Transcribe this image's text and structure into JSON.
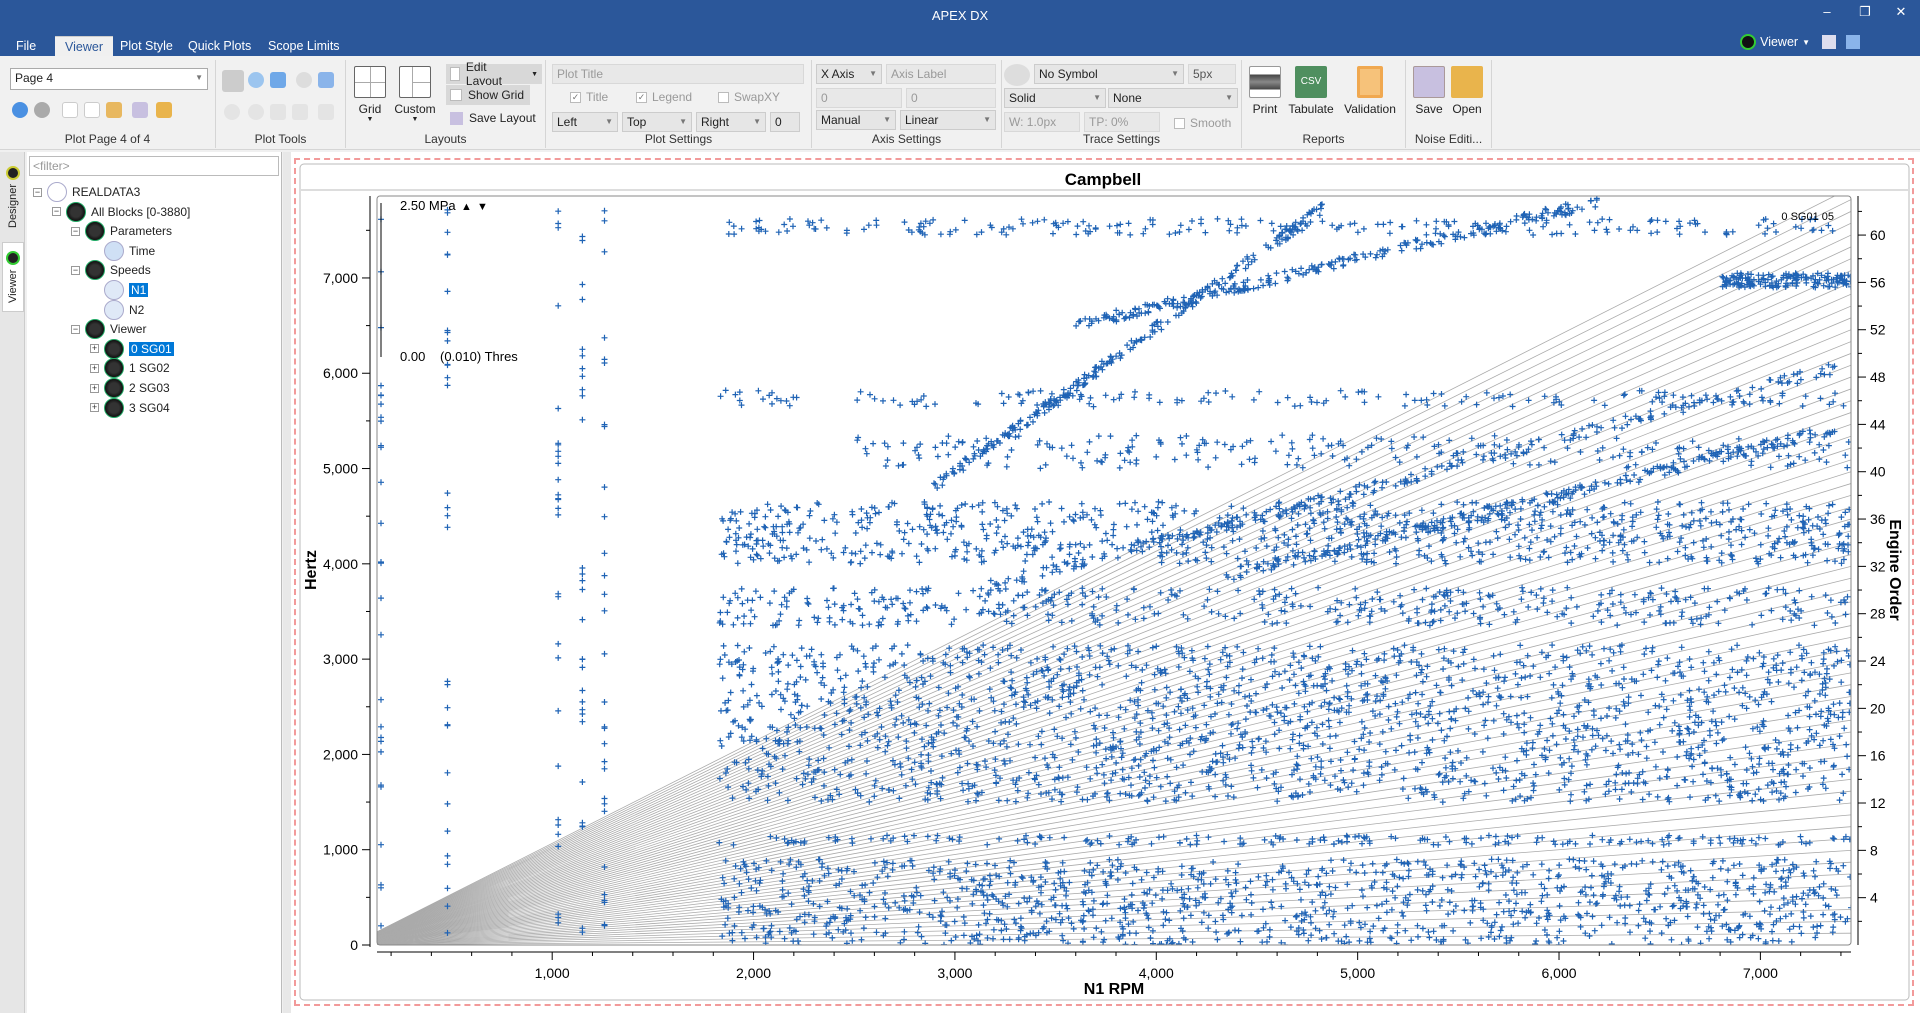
{
  "window": {
    "title": "APEX DX",
    "minimize": "‒",
    "restore": "❐",
    "close": "✕"
  },
  "menu": {
    "tabs": [
      "File",
      "Viewer",
      "Plot Style",
      "Quick Plots",
      "Scope Limits"
    ],
    "active": "Viewer",
    "mode_label": "Viewer"
  },
  "ribbon": {
    "plot_page": {
      "page_select": "Page 4",
      "label": "Plot Page 4 of 4"
    },
    "plot_tools": {
      "label": "Plot Tools"
    },
    "layouts": {
      "grid": "Grid",
      "custom": "Custom",
      "edit_layout": "Edit Layout",
      "show_grid": "Show Grid",
      "save_layout": "Save Layout",
      "label": "Layouts"
    },
    "plot_settings": {
      "title_placeholder": "Plot Title",
      "title_check": "Title",
      "title_checked": true,
      "legend_check": "Legend",
      "legend_checked": true,
      "swapxy_check": "SwapXY",
      "swapxy_checked": false,
      "left": "Left",
      "top": "Top",
      "right": "Right",
      "spin": "0",
      "label": "Plot Settings"
    },
    "axis_settings": {
      "axis": "X Axis",
      "axis_label_placeholder": "Axis Label",
      "min": "0",
      "max": "0",
      "mode": "Manual",
      "scale": "Linear",
      "label": "Axis Settings"
    },
    "trace_settings": {
      "symbol": "No Symbol",
      "size": "5px",
      "line": "Solid",
      "fill": "None",
      "width": "W: 1.0px",
      "transparency": "TP: 0%",
      "smooth": "Smooth",
      "smooth_checked": false,
      "label": "Trace Settings"
    },
    "reports": {
      "print": "Print",
      "tabulate": "Tabulate",
      "validation": "Validation",
      "label": "Reports"
    },
    "noise": {
      "save": "Save",
      "open": "Open",
      "label": "Noise Editi..."
    }
  },
  "side_tabs": [
    "Designer",
    "Viewer"
  ],
  "tree": {
    "filter_placeholder": "<filter>",
    "nodes": [
      {
        "label": "REALDATA3",
        "level": 0,
        "expander": "−",
        "icon": "file-icon"
      },
      {
        "label": "All Blocks [0-3880]",
        "level": 1,
        "expander": "−",
        "icon": "blocks-icon"
      },
      {
        "label": "Parameters",
        "level": 2,
        "expander": "−",
        "icon": "gauge-icon"
      },
      {
        "label": "Time",
        "level": 3,
        "expander": "",
        "icon": "stopwatch-icon"
      },
      {
        "label": "Speeds",
        "level": 2,
        "expander": "−",
        "icon": "gauge-icon"
      },
      {
        "label": "N1",
        "level": 3,
        "expander": "",
        "icon": "speedometer-icon",
        "selected": true
      },
      {
        "label": "N2",
        "level": 3,
        "expander": "",
        "icon": "speedometer-icon"
      },
      {
        "label": "Viewer",
        "level": 2,
        "expander": "−",
        "icon": "binoculars-icon"
      },
      {
        "label": "0 SG01",
        "level": 3,
        "expander": "+",
        "icon": "sensor-icon",
        "selected": true
      },
      {
        "label": "1 SG02",
        "level": 3,
        "expander": "+",
        "icon": "sensor-icon"
      },
      {
        "label": "2 SG03",
        "level": 3,
        "expander": "+",
        "icon": "sensor-icon"
      },
      {
        "label": "3 SG04",
        "level": 3,
        "expander": "+",
        "icon": "sensor-icon"
      }
    ]
  },
  "chart_data": {
    "type": "scatter",
    "title": "Campbell",
    "xlabel": "N1 RPM",
    "ylabel": "Hertz",
    "y2label": "Engine Order",
    "xlim": [
      130,
      7450
    ],
    "ylim": [
      0,
      7860
    ],
    "xticks": [
      1000,
      2000,
      3000,
      4000,
      5000,
      6000,
      7000
    ],
    "xtick_labels": [
      "1,000",
      "2,000",
      "3,000",
      "4,000",
      "5,000",
      "6,000",
      "7,000"
    ],
    "yticks": [
      0,
      1000,
      2000,
      3000,
      4000,
      5000,
      6000,
      7000
    ],
    "ytick_labels": [
      "0",
      "1,000",
      "2,000",
      "3,000",
      "4,000",
      "5,000",
      "6,000",
      "7,000"
    ],
    "engine_order_ticks": [
      4,
      8,
      12,
      16,
      20,
      24,
      28,
      32,
      36,
      40,
      44,
      48,
      52,
      56,
      60
    ],
    "engine_order_lines": {
      "from": 1,
      "to": 64
    },
    "legend": {
      "entry": "0 SG01 05",
      "placement": "top-right"
    },
    "scale_legend": {
      "max": "2.50 MPa",
      "min": "0.00",
      "threshold": "(0.010) Thres"
    },
    "marker": "+",
    "color": "#1f63b5",
    "order_line_color": "#aaaaaa",
    "series": [
      {
        "name": "0 SG01 05",
        "clusters": [
          {
            "rpm": [
              1830,
              7450
            ],
            "hz": [
              0,
              900
            ],
            "density": 1.0
          },
          {
            "rpm": [
              1830,
              7450
            ],
            "hz": [
              1050,
              1150
            ],
            "density": 0.4
          },
          {
            "rpm": [
              1830,
              7450
            ],
            "hz": [
              1500,
              3150
            ],
            "density": 1.0
          },
          {
            "rpm": [
              1830,
              7450
            ],
            "hz": [
              3350,
              3750
            ],
            "density": 0.6
          },
          {
            "rpm": [
              1830,
              7450
            ],
            "hz": [
              4000,
              4650
            ],
            "density": 0.9
          },
          {
            "rpm": [
              2500,
              7450
            ],
            "hz": [
              5000,
              5350
            ],
            "density": 0.35
          },
          {
            "rpm": [
              1830,
              7450
            ],
            "hz": [
              5650,
              5820
            ],
            "density": 0.3
          },
          {
            "rpm": [
              1830,
              7450
            ],
            "hz": [
              7450,
              7620
            ],
            "density": 0.4
          },
          {
            "rpm": [
              6800,
              7450
            ],
            "hz": [
              6900,
              7050
            ],
            "density": 0.3
          }
        ],
        "streaks": [
          {
            "rpm": [
              3124,
              7384
            ],
            "hz": [
              3745,
              6062
            ]
          },
          {
            "rpm": [
              2880,
              4828
            ],
            "hz": [
              4775,
              7735
            ]
          },
          {
            "rpm": [
              4340,
              7384
            ],
            "hz": [
              3874,
              5418
            ]
          },
          {
            "rpm": [
              3600,
              6200
            ],
            "hz": [
              6500,
              7800
            ]
          }
        ],
        "low_speed_columns": [
          150,
          480,
          1030,
          1150,
          1260
        ]
      }
    ]
  }
}
